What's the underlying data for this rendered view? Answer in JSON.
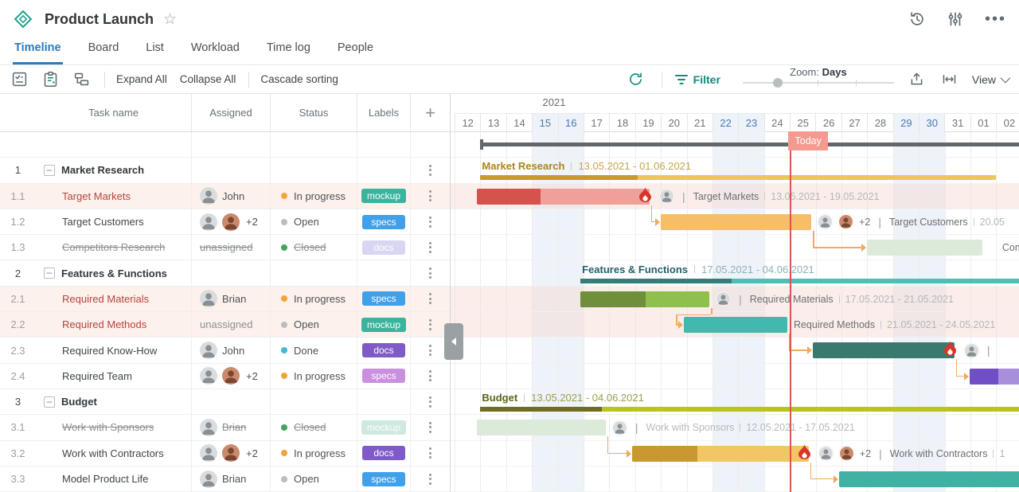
{
  "header": {
    "title": "Product Launch"
  },
  "tabs": [
    "Timeline",
    "Board",
    "List",
    "Workload",
    "Time log",
    "People"
  ],
  "toolbar": {
    "expand_all": "Expand All",
    "collapse_all": "Collapse All",
    "cascade_sorting": "Cascade sorting",
    "filter": "Filter",
    "zoom_prefix": "Zoom:",
    "zoom_value": "Days",
    "view": "View"
  },
  "grid": {
    "columns": [
      "Task name",
      "Assigned",
      "Status",
      "Labels"
    ],
    "add_column": "+"
  },
  "timeline": {
    "year": "2021",
    "today": "Today",
    "days": [
      "12",
      "13",
      "14",
      "15",
      "16",
      "17",
      "18",
      "19",
      "20",
      "21",
      "22",
      "23",
      "24",
      "25",
      "26",
      "27",
      "28",
      "29",
      "30",
      "31",
      "01",
      "02"
    ],
    "weekend_indices": [
      3,
      4,
      10,
      11,
      17,
      18
    ],
    "today_day_index": 13
  },
  "colors": {
    "accent_teal": "#12897d",
    "tab_blue": "#2b7cbd",
    "today_red": "#e05252",
    "schemes": {
      "gold": {
        "main": "#eec45c",
        "prog": "#c9992b"
      },
      "red": {
        "main": "#f0a09a",
        "prog": "#d5534d"
      },
      "orange": {
        "main": "#f7bd69",
        "prog": "#f7bd69"
      },
      "fadedGreen": {
        "main": "#dcead9",
        "prog": "#dcead9"
      },
      "tealSum": {
        "main": "#4cc0b4",
        "prog": "#337e79"
      },
      "green": {
        "main": "#8fc04c",
        "prog": "#6f8f3b"
      },
      "cyan": {
        "main": "#43b8af",
        "prog": "#43b8af"
      },
      "sea": {
        "main": "#3a7a6e",
        "prog": "#3a7a6e"
      },
      "purple": {
        "main": "#a78fdc",
        "prog": "#6f4fc3"
      },
      "olive": {
        "main": "#b9c41f",
        "prog": "#6f6e20"
      },
      "gold2": {
        "main": "#f2c763",
        "prog": "#c9992f"
      },
      "teal": {
        "main": "#41b1a4",
        "prog": "#41b1a4"
      }
    }
  },
  "rows": [
    {
      "kind": "spacer"
    },
    {
      "kind": "parent",
      "wbs": "1",
      "name": "Market Research",
      "bar": {
        "type": "summary",
        "scheme": "gold",
        "start": 1.0,
        "end": 21.0,
        "prog": 7.1,
        "dates": "13.05.2021 - 01.06.2021",
        "nameColor": "#a8861d",
        "dateColor": "#c2a54b"
      }
    },
    {
      "kind": "task",
      "wbs": "1.1",
      "name": "Target Markets",
      "red": true,
      "assigned": {
        "mode": "single",
        "name": "John"
      },
      "status": {
        "label": "In progress",
        "color": "#f2a33c"
      },
      "chip": {
        "text": "mockup",
        "bg": "#3cb39c"
      },
      "bar": {
        "type": "task",
        "scheme": "red",
        "start": 0.86,
        "end": 7.56,
        "prog": 3.33,
        "flame": true,
        "avatars": 1,
        "caption": "Target Markets",
        "dates": "13.05.2021 - 19.05.2021"
      }
    },
    {
      "kind": "task",
      "wbs": "1.2",
      "name": "Target Customers",
      "assigned": {
        "mode": "pair",
        "extra": "+2"
      },
      "status": {
        "label": "Open",
        "color": "#b9bdc1"
      },
      "chip": {
        "text": "specs",
        "bg": "#41a0ea"
      },
      "bar": {
        "type": "task",
        "scheme": "orange",
        "start": 8.0,
        "end": 13.83,
        "avatars": 2,
        "extra": "+2",
        "caption": "Target Customers",
        "dates": "20.05"
      }
    },
    {
      "kind": "task",
      "wbs": "1.3",
      "name": "Competitors Research",
      "struck": true,
      "assigned": {
        "mode": "none",
        "label": "unassigned",
        "struck": true
      },
      "status": {
        "label": "Closed",
        "color": "#46a35a",
        "struck": true
      },
      "chip": {
        "text": "docs",
        "bg": "#d9d6f2"
      },
      "bar": {
        "type": "task",
        "scheme": "fadedGreen",
        "start": 16.0,
        "end": 20.46,
        "plainCaption": "Competitors Research"
      }
    },
    {
      "kind": "parent",
      "wbs": "2",
      "name": "Features & Functions",
      "bar": {
        "type": "summary",
        "scheme": "tealSum",
        "start": 4.88,
        "end": 22,
        "prog": 10.74,
        "dates": "17.05.2021 - 04.06.2021",
        "nameColor": "#265f6b",
        "dateColor": "#8fb0b5"
      }
    },
    {
      "kind": "task",
      "wbs": "2.1",
      "name": "Required Materials",
      "red": true,
      "assigned": {
        "mode": "single",
        "name": "Brian"
      },
      "status": {
        "label": "In progress",
        "color": "#f2a33c"
      },
      "chip": {
        "text": "specs",
        "bg": "#41a0ea"
      },
      "bar": {
        "type": "task",
        "scheme": "green",
        "start": 4.88,
        "end": 9.88,
        "prog": 7.41,
        "avatars": 1,
        "caption": "Required Materials",
        "dates": "17.05.2021 - 21.05.2021"
      }
    },
    {
      "kind": "task",
      "wbs": "2.2",
      "name": "Required Methods",
      "red": true,
      "assigned": {
        "mode": "none",
        "label": "unassigned"
      },
      "status": {
        "label": "Open",
        "color": "#b9bdc1"
      },
      "chip": {
        "text": "mockup",
        "bg": "#3cb39c"
      },
      "bar": {
        "type": "task",
        "scheme": "cyan",
        "start": 8.89,
        "end": 12.9,
        "caption": "Required Methods",
        "dates": "21.05.2021 - 24.05.2021"
      }
    },
    {
      "kind": "task",
      "wbs": "2.3",
      "name": "Required Know-How",
      "assigned": {
        "mode": "single",
        "name": "John"
      },
      "status": {
        "label": "Done",
        "color": "#42b9d5"
      },
      "chip": {
        "text": "docs",
        "bg": "#7e5bc7"
      },
      "bar": {
        "type": "task",
        "scheme": "sea",
        "start": 13.89,
        "end": 19.38,
        "flame": true,
        "avatars": 1,
        "pipeOnly": true
      }
    },
    {
      "kind": "task",
      "wbs": "2.4",
      "name": "Required Team",
      "assigned": {
        "mode": "pair",
        "extra": "+2"
      },
      "status": {
        "label": "In progress",
        "color": "#f2a33c"
      },
      "chip": {
        "text": "specs",
        "bg": "#c990dd"
      },
      "bar": {
        "type": "task",
        "scheme": "purple",
        "start": 19.97,
        "end": 22,
        "prog": 21.08
      }
    },
    {
      "kind": "parent",
      "wbs": "3",
      "name": "Budget",
      "bar": {
        "type": "summary",
        "scheme": "olive",
        "start": 1.0,
        "end": 22,
        "prog": 5.71,
        "dates": "13.05.2021 - 04.06.2021",
        "nameColor": "#5c6318",
        "dateColor": "#9aa04a"
      }
    },
    {
      "kind": "task",
      "wbs": "3.1",
      "name": "Work with Sponsors",
      "struck": true,
      "assigned": {
        "mode": "single",
        "name": "Brian",
        "struck": true
      },
      "status": {
        "label": "Closed",
        "color": "#46a35a",
        "struck": true
      },
      "chip": {
        "text": "mockup",
        "bg": "#cfe8e0"
      },
      "bar": {
        "type": "task",
        "scheme": "fadedGreen",
        "start": 0.86,
        "end": 5.86,
        "avatars": 1,
        "caption": "Work with Sponsors",
        "dates": "12.05.2021 - 17.05.2021",
        "muted": true
      }
    },
    {
      "kind": "task",
      "wbs": "3.2",
      "name": "Work with Contractors",
      "assigned": {
        "mode": "pair",
        "extra": "+2"
      },
      "status": {
        "label": "In progress",
        "color": "#f2a33c"
      },
      "chip": {
        "text": "docs",
        "bg": "#7e5bc7"
      },
      "bar": {
        "type": "task",
        "scheme": "gold2",
        "start": 6.88,
        "end": 13.73,
        "prog": 9.41,
        "flame": true,
        "avatars": 2,
        "extra": "+2",
        "caption": "Work with Contractors",
        "dates": "1"
      }
    },
    {
      "kind": "task",
      "wbs": "3.3",
      "name": "Model Product Life",
      "assigned": {
        "mode": "single",
        "name": "Brian"
      },
      "status": {
        "label": "Open",
        "color": "#b9bdc1"
      },
      "chip": {
        "text": "specs",
        "bg": "#41a0ea"
      },
      "bar": {
        "type": "task",
        "scheme": "teal",
        "start": 14.9,
        "end": 22
      }
    }
  ],
  "links": [
    [
      2,
      3
    ],
    [
      3,
      4
    ],
    [
      6,
      7
    ],
    [
      7,
      8
    ],
    [
      8,
      9
    ],
    [
      11,
      12
    ],
    [
      12,
      13
    ]
  ]
}
